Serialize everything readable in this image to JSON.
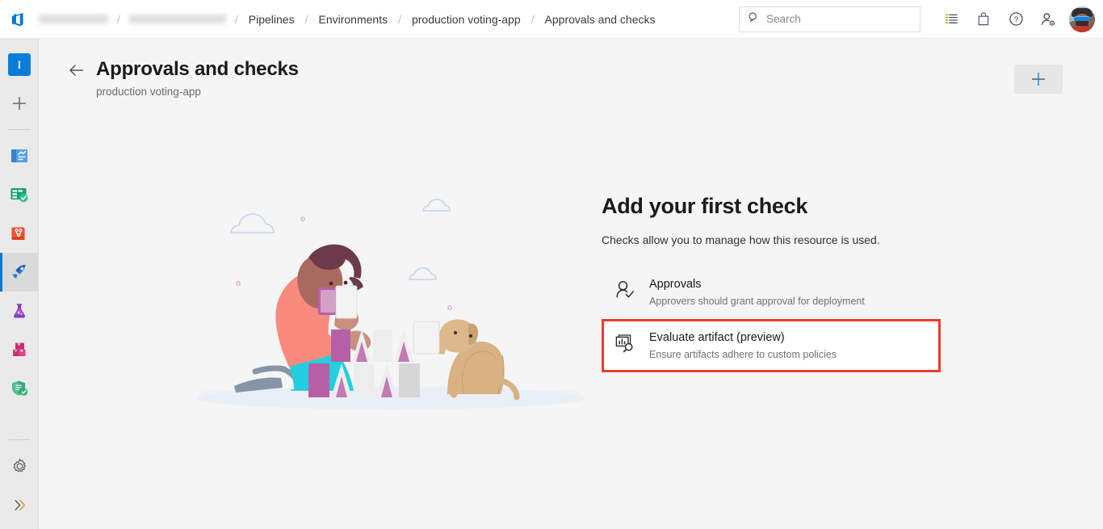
{
  "topbar": {
    "logo_icon": "azure-devops-logo",
    "breadcrumb": [
      {
        "label": "",
        "redacted": true,
        "width": 86
      },
      {
        "label": "",
        "redacted": true,
        "width": 120
      },
      {
        "label": "Pipelines",
        "redacted": false
      },
      {
        "label": "Environments",
        "redacted": false
      },
      {
        "label": "production voting-app",
        "redacted": false
      },
      {
        "label": "Approvals and checks",
        "redacted": false
      }
    ],
    "separator": "/",
    "search": {
      "placeholder": "Search",
      "value": "",
      "icon": "search-icon"
    },
    "actions": [
      {
        "name": "boards-list-icon",
        "title": "Work items"
      },
      {
        "name": "marketplace-bag-icon",
        "title": "Marketplace"
      },
      {
        "name": "help-question-icon",
        "title": "Help"
      },
      {
        "name": "user-settings-icon",
        "title": "User settings"
      }
    ],
    "avatar": {
      "name": "user-avatar",
      "title": "Account manager"
    }
  },
  "rail": {
    "project_badge": {
      "label": "I",
      "color": "#0a7ddb"
    },
    "add_label": "+",
    "items": [
      {
        "name": "sidebar-item-overview",
        "label": "Overview",
        "selected": false
      },
      {
        "name": "sidebar-item-boards",
        "label": "Boards",
        "selected": false
      },
      {
        "name": "sidebar-item-repos",
        "label": "Repos",
        "selected": false
      },
      {
        "name": "sidebar-item-pipelines",
        "label": "Pipelines",
        "selected": true
      },
      {
        "name": "sidebar-item-test-plans",
        "label": "Test Plans",
        "selected": false
      },
      {
        "name": "sidebar-item-artifacts",
        "label": "Artifacts",
        "selected": false
      },
      {
        "name": "sidebar-item-advanced-security",
        "label": "Advanced Security",
        "selected": false
      }
    ],
    "bottom": [
      {
        "name": "project-settings-gear-icon",
        "label": "Project settings"
      },
      {
        "name": "expand-chevrons-icon",
        "label": "Expand"
      }
    ]
  },
  "page": {
    "back_label": "Back",
    "title": "Approvals and checks",
    "subtitle": "production voting-app",
    "add_button_label": "+"
  },
  "empty_state": {
    "illustration_alt": "Person stacking cards with a dog",
    "heading": "Add your first check",
    "description": "Checks allow you to manage how this resource is used.",
    "checks": [
      {
        "name": "Approvals",
        "sub": "Approvers should grant approval for deployment",
        "icon": "person-check-icon",
        "highlighted": false
      },
      {
        "name": "Evaluate artifact (preview)",
        "sub": "Ensure artifacts adhere to custom policies",
        "icon": "artifact-inspect-icon",
        "highlighted": true
      }
    ]
  },
  "colors": {
    "accent": "#0078d4",
    "highlight_border": "#f03b2f",
    "page_background": "#f5f5f5",
    "rail_background": "#eaeaea"
  }
}
